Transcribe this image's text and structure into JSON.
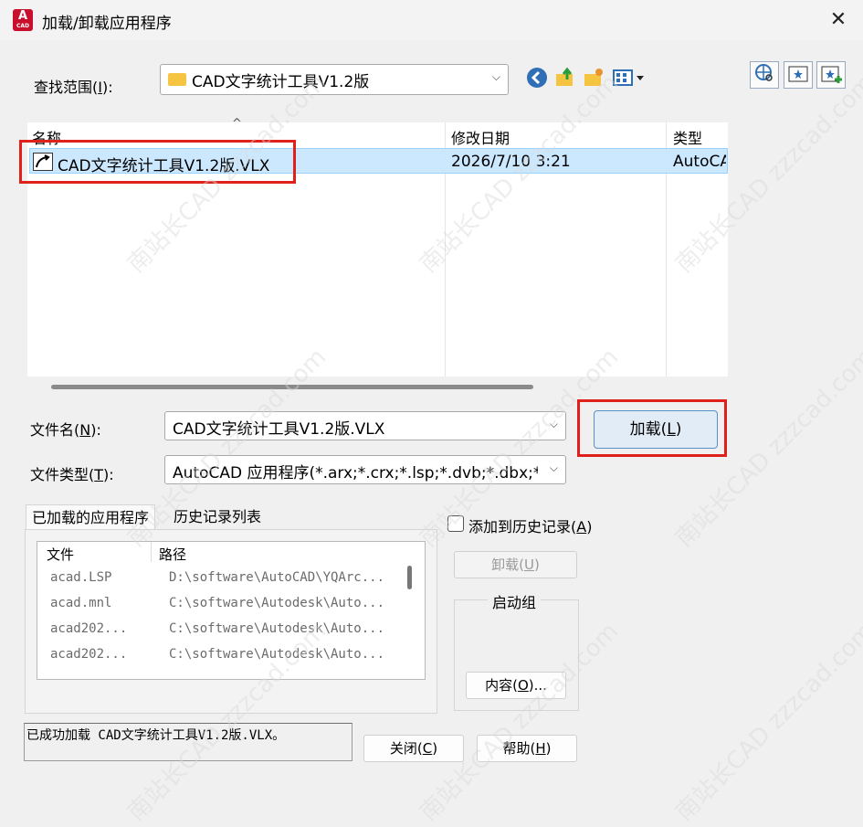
{
  "window": {
    "title": "加载/卸载应用程序",
    "app_icon_letter": "A",
    "app_icon_sub": "CAD",
    "close_glyph": "✕"
  },
  "lookin": {
    "label": "查找范围(I):",
    "value": "CAD文字统计工具V1.2版",
    "arrow": "⌵"
  },
  "columns": {
    "name": "名称",
    "modified": "修改日期",
    "type": "类型",
    "sort_glyph": "^"
  },
  "files": [
    {
      "name": "CAD文字统计工具V1.2版.VLX",
      "modified": "2026/7/10 3:21",
      "type": "AutoCAD"
    }
  ],
  "filename": {
    "label": "文件名(N):",
    "value": "CAD文字统计工具V1.2版.VLX",
    "arrow": "⌵"
  },
  "filetype": {
    "label": "文件类型(T):",
    "value": "AutoCAD 应用程序(*.arx;*.crx;*.lsp;*.dvb;*.dbx;*.v",
    "arrow": "⌵"
  },
  "load_button": "加载(L)",
  "tabs": {
    "loaded": "已加载的应用程序",
    "history": "历史记录列表"
  },
  "loaded_list": {
    "header_file": "文件",
    "header_path": "路径",
    "rows": [
      {
        "file": "acad.LSP",
        "path": "D:\\software\\AutoCAD\\YQArc..."
      },
      {
        "file": "acad.mnl",
        "path": "C:\\software\\Autodesk\\Auto..."
      },
      {
        "file": "acad202...",
        "path": "C:\\software\\Autodesk\\Auto..."
      },
      {
        "file": "acad202...",
        "path": "C:\\software\\Autodesk\\Auto..."
      }
    ]
  },
  "add_history": "添加到历史记录(A)",
  "unload_button": "卸载(U)",
  "startup_group": {
    "title": "启动组",
    "contents_button": "内容(O)..."
  },
  "status_text": "已成功加载 CAD文字统计工具V1.2版.VLX。",
  "close_button": "关闭(C)",
  "help_button": "帮助(H)",
  "watermark": "南站长CAD zzzcad.com",
  "colors": {
    "highlight": "#e0201b",
    "selection": "#cce8ff",
    "accent": "#c8102e"
  }
}
